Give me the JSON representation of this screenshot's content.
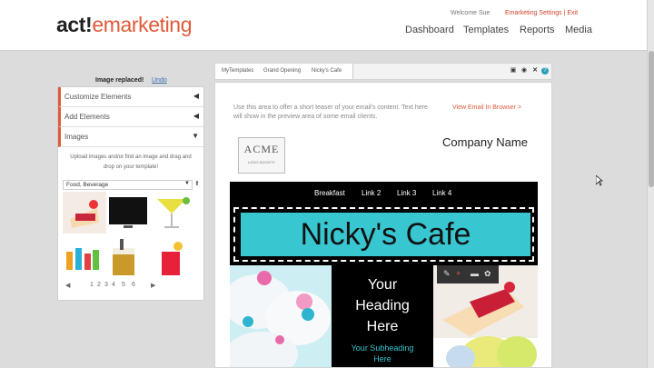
{
  "header": {
    "logo_act": "act!",
    "logo_rest": "emarketing",
    "welcome": "Welcome Sue",
    "account_links": "Emarketing Settings | Exit",
    "nav": [
      "Dashboard",
      "Templates",
      "Reports",
      "Media"
    ]
  },
  "sidebar": {
    "status": "Image replaced!",
    "undo": "Undo",
    "sections": [
      {
        "label": "Customize Elements",
        "arrow": "◀"
      },
      {
        "label": "Add Elements",
        "arrow": "◀"
      },
      {
        "label": "Images",
        "arrow": "▼"
      }
    ],
    "help_text": "Upload images and/or find an image and drag and drop on your template!",
    "category": "Food, Beverage",
    "upload_icon": "⬆",
    "prev": "◀",
    "next": "▶",
    "pages": [
      "1",
      "2",
      "3",
      "4",
      "5",
      "6"
    ]
  },
  "editor": {
    "breadcrumbs": [
      "MyTemplates",
      "Grand Opening",
      "Nicky's Cafe"
    ],
    "toolbar_icons": [
      "save-icon",
      "preview-icon",
      "close-icon",
      "help-icon"
    ],
    "teaser": "Use this area to offer a short teaser of your email's content. Text here will show in the preview area of some email clients.",
    "view_link": "View Email In Browser >",
    "logo_name": "ACME",
    "logo_sub": "LOGO SOCIETY",
    "company_name": "Company Name",
    "email_nav": [
      "Breakfast",
      "Link 2",
      "Link 3",
      "Link 4"
    ],
    "banner_title": "Nicky's Cafe",
    "heading": "Your Heading Here",
    "subheading": "Your Subheading Here",
    "image_tools": [
      "edit-icon",
      "add-icon",
      "minus-icon",
      "settings-icon"
    ]
  },
  "colors": {
    "brand_orange": "#e05a3a",
    "banner_teal": "#38c6d1",
    "email_black": "#000000"
  }
}
